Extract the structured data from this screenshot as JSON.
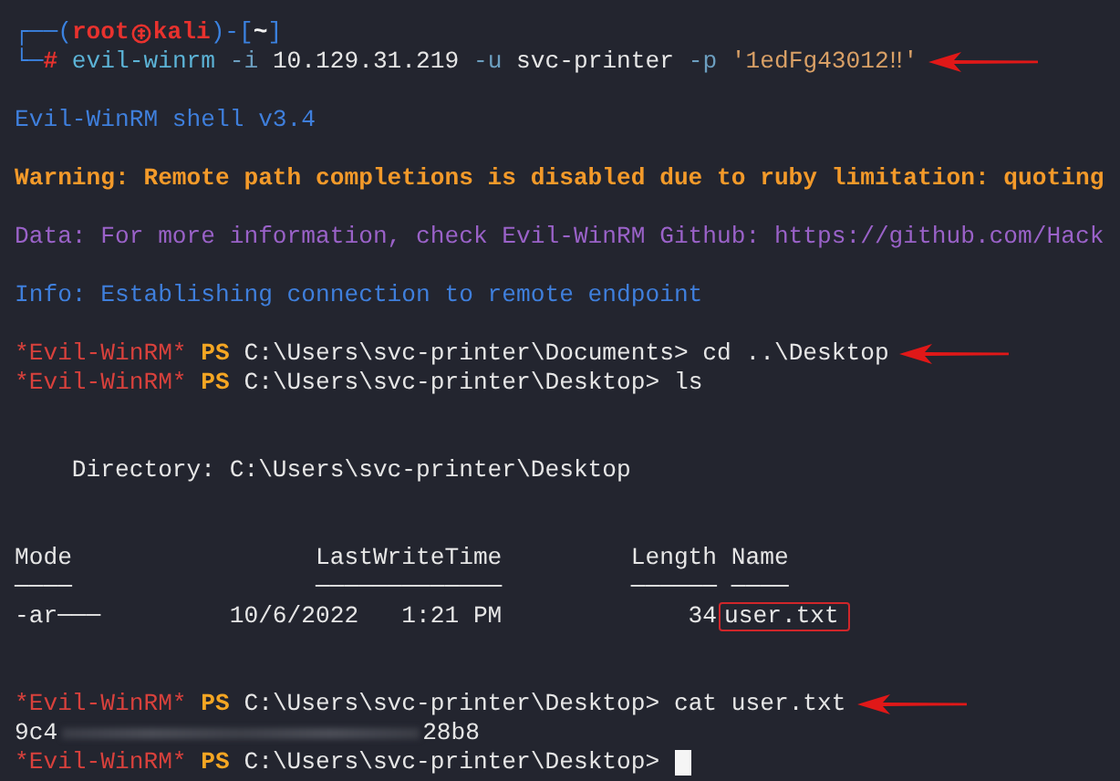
{
  "terminal": {
    "lines": [
      {
        "kind": "text",
        "arrow": false,
        "segments": [
          {
            "kind": "frame",
            "text": "┌──("
          },
          {
            "kind": "user",
            "text": "root"
          },
          {
            "kind": "symbol"
          },
          {
            "kind": "user",
            "text": "kali"
          },
          {
            "kind": "frame",
            "text": ")-["
          },
          {
            "kind": "path",
            "text": "~"
          },
          {
            "kind": "frame",
            "text": "]"
          }
        ]
      },
      {
        "kind": "text",
        "arrow": true,
        "segments": [
          {
            "kind": "frame",
            "text": "└─"
          },
          {
            "kind": "hash",
            "text": "#"
          },
          {
            "kind": "command",
            "text": " evil-winrm"
          },
          {
            "kind": "option",
            "text": " -i"
          },
          {
            "kind": "plain",
            "text": " 10.129.31.219"
          },
          {
            "kind": "option",
            "text": " -u"
          },
          {
            "kind": "plain",
            "text": " svc-printer"
          },
          {
            "kind": "option",
            "text": " -p"
          },
          {
            "kind": "string",
            "text": " '1edFg43012‼'"
          }
        ]
      },
      {
        "kind": "blank"
      },
      {
        "kind": "text",
        "arrow": false,
        "segments": [
          {
            "kind": "info",
            "text": "Evil-WinRM shell v3.4"
          }
        ]
      },
      {
        "kind": "blank"
      },
      {
        "kind": "text",
        "arrow": false,
        "segments": [
          {
            "kind": "warning",
            "text": "Warning: Remote path completions is disabled due to ruby limitation: quoting"
          }
        ]
      },
      {
        "kind": "blank"
      },
      {
        "kind": "text",
        "arrow": false,
        "segments": [
          {
            "kind": "data",
            "text": "Data: For more information, check Evil-WinRM Github: https://github.com/Hack"
          }
        ]
      },
      {
        "kind": "blank"
      },
      {
        "kind": "text",
        "arrow": false,
        "segments": [
          {
            "kind": "info",
            "text": "Info: Establishing connection to remote endpoint"
          }
        ]
      },
      {
        "kind": "blank"
      },
      {
        "kind": "text",
        "arrow": true,
        "segments": [
          {
            "kind": "shell",
            "text": "*Evil-WinRM*"
          },
          {
            "kind": "ps",
            "text": " PS"
          },
          {
            "kind": "plain",
            "text": " C:\\Users\\svc-printer\\Documents> cd ..\\Desktop"
          }
        ]
      },
      {
        "kind": "text",
        "arrow": false,
        "segments": [
          {
            "kind": "shell",
            "text": "*Evil-WinRM*"
          },
          {
            "kind": "ps",
            "text": " PS"
          },
          {
            "kind": "plain",
            "text": " C:\\Users\\svc-printer\\Desktop> ls"
          }
        ]
      },
      {
        "kind": "blank"
      },
      {
        "kind": "blank"
      },
      {
        "kind": "text",
        "arrow": false,
        "segments": [
          {
            "kind": "plain",
            "text": "    Directory: C:\\Users\\svc-printer\\Desktop"
          }
        ]
      },
      {
        "kind": "blank"
      },
      {
        "kind": "blank"
      },
      {
        "kind": "text",
        "arrow": false,
        "segments": [
          {
            "kind": "plain",
            "text": "Mode                 LastWriteTime         Length Name"
          }
        ]
      },
      {
        "kind": "text",
        "arrow": false,
        "segments": [
          {
            "kind": "plain",
            "text": "────                 ─────────────         ────── ────"
          }
        ]
      },
      {
        "kind": "text",
        "arrow": false,
        "segments": [
          {
            "kind": "plain",
            "text": "-ar───         10/6/2022   1:21 PM             34"
          },
          {
            "kind": "boxed",
            "text": "user.txt"
          }
        ]
      },
      {
        "kind": "blank"
      },
      {
        "kind": "blank"
      },
      {
        "kind": "text",
        "arrow": true,
        "segments": [
          {
            "kind": "shell",
            "text": "*Evil-WinRM*"
          },
          {
            "kind": "ps",
            "text": " PS"
          },
          {
            "kind": "plain",
            "text": " C:\\Users\\svc-printer\\Desktop> cat user.txt"
          }
        ]
      },
      {
        "kind": "text",
        "arrow": false,
        "segments": [
          {
            "kind": "plain",
            "text": "9c4"
          },
          {
            "kind": "redacted"
          },
          {
            "kind": "plain",
            "text": "28b8"
          }
        ]
      },
      {
        "kind": "text",
        "arrow": false,
        "segments": [
          {
            "kind": "shell",
            "text": "*Evil-WinRM*"
          },
          {
            "kind": "ps",
            "text": " PS"
          },
          {
            "kind": "plain",
            "text": " C:\\Users\\svc-printer\\Desktop>"
          },
          {
            "kind": "cursor"
          }
        ]
      }
    ]
  }
}
